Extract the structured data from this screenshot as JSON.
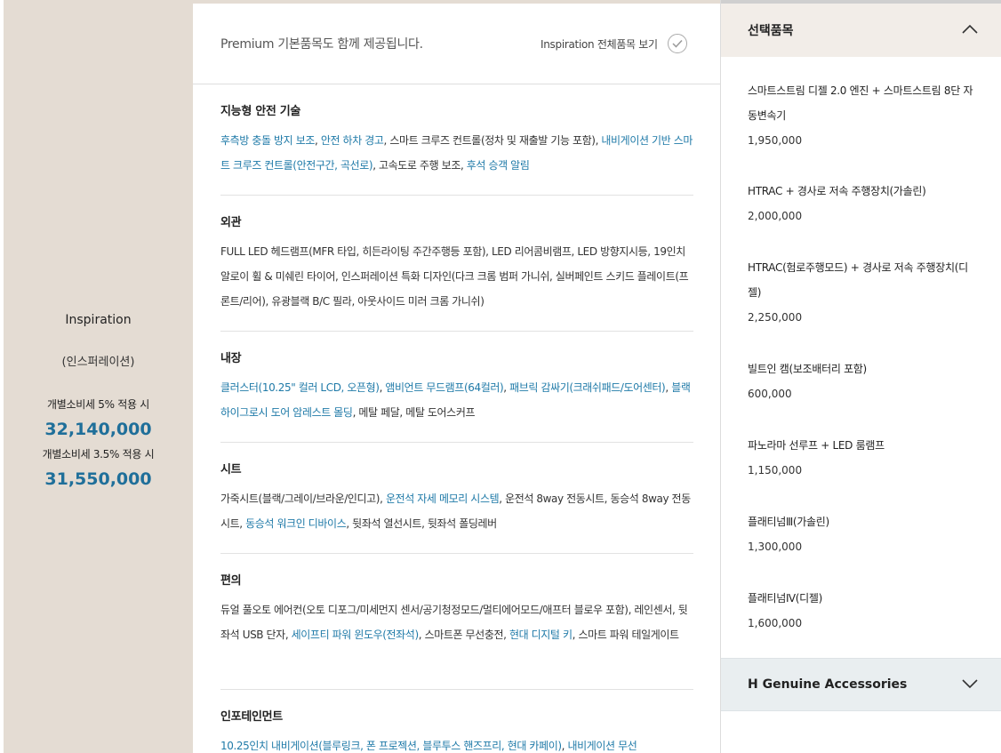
{
  "trim": {
    "name": "Inspiration",
    "sub": "(인스퍼레이션)",
    "tax5_label": "개별소비세 5% 적용 시",
    "tax5_price": "32,140,000",
    "tax35_label": "개별소비세 3.5% 적용 시",
    "tax35_price": "31,550,000"
  },
  "basic": {
    "notice": "Premium 기본품목도 함께 제공됩니다.",
    "all_items_link": "Inspiration 전체품목 보기"
  },
  "features": [
    {
      "title": "지능형 안전 기술",
      "segments": [
        {
          "text": "후측방 충돌 방지 보조",
          "hl": true
        },
        {
          "text": ", ",
          "hl": false
        },
        {
          "text": "안전 하차 경고",
          "hl": true
        },
        {
          "text": ", 스마트 크루즈 컨트롤(정차 및 재출발 기능 포함), ",
          "hl": false
        },
        {
          "text": "내비게이션 기반 스마트 크루즈 컨트롤(안전구간, 곡선로)",
          "hl": true
        },
        {
          "text": ", 고속도로 주행 보조, ",
          "hl": false
        },
        {
          "text": "후석 승객 알림",
          "hl": true
        }
      ]
    },
    {
      "title": "외관",
      "segments": [
        {
          "text": "FULL LED 헤드램프(MFR 타입, 히든라이팅 주간주행등 포함), LED 리어콤비램프, LED 방향지시등, 19인치 알로이 휠 & 미쉐린 타이어, 인스퍼레이션 특화 디자인(다크 크롬 범퍼 가니쉬, 실버페인트 스키드 플레이트(프론트/리어), 유광블랙 B/C 필라, 아웃사이드 미러 크롬 가니쉬)",
          "hl": false
        }
      ]
    },
    {
      "title": "내장",
      "segments": [
        {
          "text": "클러스터(10.25\" 컬러 LCD, 오픈형)",
          "hl": true
        },
        {
          "text": ", ",
          "hl": false
        },
        {
          "text": "앰비언트 무드램프(64컬러)",
          "hl": true
        },
        {
          "text": ", ",
          "hl": false
        },
        {
          "text": "패브릭 감싸기(크래쉬패드/도어센터)",
          "hl": true
        },
        {
          "text": ", ",
          "hl": false
        },
        {
          "text": "블랙 하이그로시 도어 암레스트 몰딩",
          "hl": true
        },
        {
          "text": ", 메탈 페달, 메탈 도어스커프",
          "hl": false
        }
      ]
    },
    {
      "title": "시트",
      "segments": [
        {
          "text": "가죽시트(블랙/그레이/브라운/인디고), ",
          "hl": false
        },
        {
          "text": "운전석 자세 메모리 시스템",
          "hl": true
        },
        {
          "text": ", 운전석 8way 전동시트, 동승석 8way 전동시트, ",
          "hl": false
        },
        {
          "text": "동승석 워크인 디바이스",
          "hl": true
        },
        {
          "text": ", 뒷좌석 열선시트, 뒷좌석 폴딩레버",
          "hl": false
        }
      ]
    },
    {
      "title": "편의",
      "segments": [
        {
          "text": "듀얼 풀오토 에어컨(오토 디포그/미세먼지 센서/공기청정모드/멀티에어모드/애프터 블로우 포함), 레인센서, 뒷좌석 USB 단자, ",
          "hl": false
        },
        {
          "text": "세이프티 파워 윈도우(전좌석)",
          "hl": true
        },
        {
          "text": ", 스마트폰 무선충전, ",
          "hl": false
        },
        {
          "text": "현대 디지털 키",
          "hl": true
        },
        {
          "text": ", 스마트 파워 테일게이트",
          "hl": false
        }
      ]
    },
    {
      "title": "인포테인먼트",
      "segments": [
        {
          "text": "10.25인치 내비게이션(블루링크, 폰 프로젝션, 블루투스 핸즈프리, 현대 카페이)",
          "hl": true
        },
        {
          "text": ", ",
          "hl": false
        },
        {
          "text": "내비게이션 무선",
          "hl": true
        }
      ]
    }
  ],
  "selected": {
    "header": "선택품목",
    "items": [
      {
        "name": "스마트스트림 디젤 2.0 엔진 + 스마트스트림 8단 자동변속기",
        "price": "1,950,000"
      },
      {
        "name": "HTRAC + 경사로 저속 주행장치(가솔린)",
        "price": "2,000,000"
      },
      {
        "name": "HTRAC(험로주행모드) + 경사로 저속 주행장치(디젤)",
        "price": "2,250,000"
      },
      {
        "name": "빌트인 캠(보조배터리 포함)",
        "price": "600,000"
      },
      {
        "name": "파노라마 선루프 + LED 룸램프",
        "price": "1,150,000"
      },
      {
        "name": "플래티넘Ⅲ(가솔린)",
        "price": "1,300,000"
      },
      {
        "name": "플래티넘Ⅳ(디젤)",
        "price": "1,600,000"
      }
    ]
  },
  "accessories": {
    "header": "H Genuine Accessories"
  }
}
